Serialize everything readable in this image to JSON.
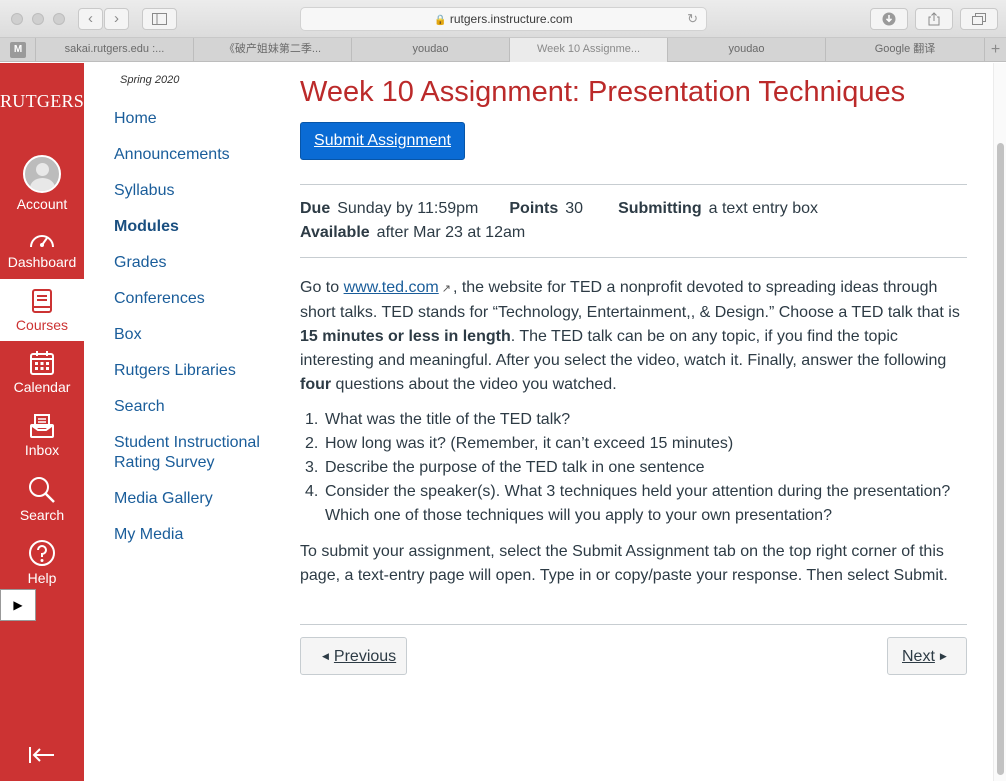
{
  "browser": {
    "url": "rutgers.instructure.com",
    "tabs": [
      {
        "label": "sakai.rutgers.edu :...",
        "active": false
      },
      {
        "label": "《破产姐妹第二季...",
        "active": false
      },
      {
        "label": "youdao",
        "active": false
      },
      {
        "label": "Week 10 Assignme...",
        "active": true
      },
      {
        "label": "youdao",
        "active": false
      },
      {
        "label": "Google 翻译",
        "active": false
      }
    ],
    "pinned_tab": "M"
  },
  "global_nav": {
    "brand": "RUTGERS",
    "items": [
      {
        "label": "Account",
        "icon": "avatar-icon"
      },
      {
        "label": "Dashboard",
        "icon": "dashboard-icon"
      },
      {
        "label": "Courses",
        "icon": "courses-icon",
        "active": true
      },
      {
        "label": "Calendar",
        "icon": "calendar-icon"
      },
      {
        "label": "Inbox",
        "icon": "inbox-icon"
      },
      {
        "label": "Search",
        "icon": "search-icon"
      },
      {
        "label": "Help",
        "icon": "help-icon"
      }
    ],
    "accent_color": "#cc3333"
  },
  "course_nav": {
    "term": "Spring 2020",
    "links": [
      {
        "label": "Home"
      },
      {
        "label": "Announcements"
      },
      {
        "label": "Syllabus"
      },
      {
        "label": "Modules",
        "current": true
      },
      {
        "label": "Grades"
      },
      {
        "label": "Conferences"
      },
      {
        "label": "Box"
      },
      {
        "label": "Rutgers Libraries"
      },
      {
        "label": "Search"
      },
      {
        "label": "Student Instructional Rating Survey"
      },
      {
        "label": "Media Gallery"
      },
      {
        "label": "My Media"
      }
    ]
  },
  "assignment": {
    "title": "Week 10 Assignment: Presentation Techniques",
    "submit_label": "Submit Assignment",
    "due_label": "Due",
    "due_value": "Sunday by 11:59pm",
    "points_label": "Points",
    "points_value": "30",
    "submitting_label": "Submitting",
    "submitting_value": "a text entry box",
    "available_label": "Available",
    "available_value": "after Mar 23 at 12am",
    "intro": {
      "p1": "Go to ",
      "link": "www.ted.com",
      "p2": ", the website for TED a nonprofit devoted to spreading ideas through short talks. TED stands for “Technology, Entertainment,, & Design.” Choose a TED talk that is ",
      "bold1": "15 minutes or less in length",
      "p3": ". The TED talk can be on any topic, if you find the topic interesting and meaningful. After you select the video, watch it. Finally, answer the following ",
      "bold2": "four",
      "p4": " questions about the video you watched."
    },
    "questions": [
      {
        "num": "1.",
        "text": "What was the title of the TED talk?"
      },
      {
        "num": "2.",
        "text": "How long was it? (Remember, it can’t exceed 15 minutes)"
      },
      {
        "num": "3.",
        "text": "Describe the purpose of the TED talk in one sentence"
      },
      {
        "num": "4.",
        "text": "Consider the speaker(s). What 3 techniques held your attention during the presentation? Which one of those techniques will you apply to your own presentation?"
      }
    ],
    "closing": "To submit your assignment, select the Submit Assignment tab on the top right corner of this page, a text-entry page will open. Type in or copy/paste your response. Then select Submit.",
    "prev_label": "Previous",
    "next_label": "Next",
    "title_color": "#bb2a2a",
    "button_color": "#0a6bd4"
  }
}
